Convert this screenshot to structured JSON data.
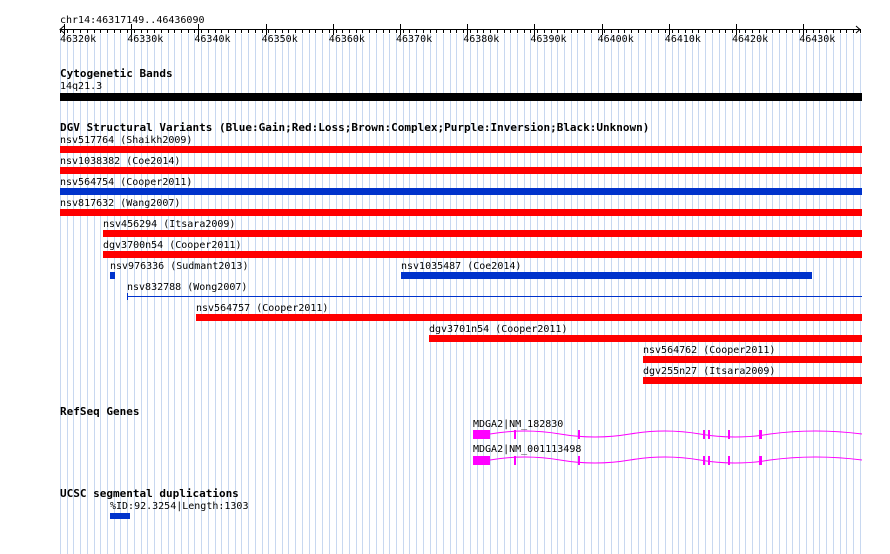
{
  "header": {
    "coordinate_label": "chr14:46317149..46436090",
    "ruler_ticks": [
      "46320k",
      "46330k",
      "46340k",
      "46350k",
      "46360k",
      "46370k",
      "46380k",
      "46390k",
      "46400k",
      "46410k",
      "46420k",
      "46430k"
    ]
  },
  "cytogenetic": {
    "title": "Cytogenetic Bands",
    "band_label": "14q21.3"
  },
  "dgv": {
    "title": "DGV Structural Variants (Blue:Gain;Red:Loss;Brown:Complex;Purple:Inversion;Black:Unknown)",
    "variants": [
      {
        "label": "nsv517764 (Shaikh2009)",
        "type": "loss"
      },
      {
        "label": "nsv1038382 (Coe2014)",
        "type": "loss"
      },
      {
        "label": "nsv564754 (Cooper2011)",
        "type": "gain"
      },
      {
        "label": "nsv817632 (Wang2007)",
        "type": "loss"
      },
      {
        "label": "nsv456294 (Itsara2009)",
        "type": "loss"
      },
      {
        "label": "dgv3700n54 (Cooper2011)",
        "type": "loss"
      },
      {
        "label": "nsv976336 (Sudmant2013)",
        "type": "gain"
      },
      {
        "label": "nsv1035487 (Coe2014)",
        "type": "gain"
      },
      {
        "label": "nsv832788 (Wong2007)",
        "type": "gain"
      },
      {
        "label": "nsv564757 (Cooper2011)",
        "type": "loss"
      },
      {
        "label": "dgv3701n54 (Cooper2011)",
        "type": "loss"
      },
      {
        "label": "nsv564762 (Cooper2011)",
        "type": "loss"
      },
      {
        "label": "dgv255n27 (Itsara2009)",
        "type": "loss"
      }
    ]
  },
  "refseq": {
    "title": "RefSeq Genes",
    "genes": [
      {
        "label": "MDGA2|NM_182830"
      },
      {
        "label": "MDGA2|NM_001113498"
      }
    ]
  },
  "segdup": {
    "title": "UCSC segmental duplications",
    "label": "%ID:92.3254|Length:1303"
  },
  "colors": {
    "loss": "#ff0000",
    "gain": "#0033cc",
    "gene": "#ff00ff",
    "band": "#000000",
    "grid": "#c8d8f0"
  }
}
